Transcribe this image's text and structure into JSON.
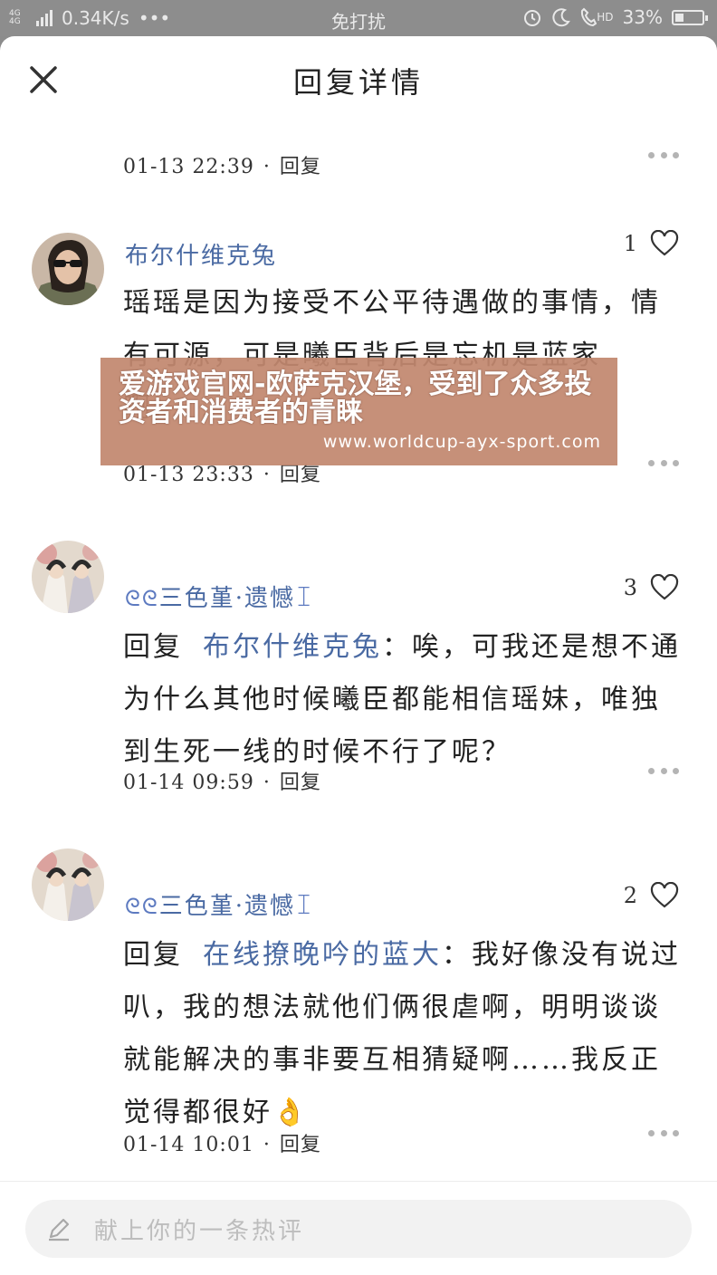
{
  "status_bar": {
    "network_tag": "4G 4G",
    "speed": "0.34K/s",
    "more_dots": "•••",
    "mode": "免打扰",
    "hd_label": "HD",
    "battery": "33%",
    "battery_level": 0.33
  },
  "header": {
    "title": "回复详情"
  },
  "top_meta": {
    "time": "01-13 22:39",
    "reply": "回复"
  },
  "comments": [
    {
      "user": "布尔什维克兔",
      "likes": "1",
      "text": "瑶瑶是因为接受不公平待遇做的事情，情有可源，可是曦臣背后是忘机是蓝家啊……",
      "time": "01-13 23:33",
      "reply": "回复"
    },
    {
      "user": "三色堇·遗憾",
      "deco_left": "ᘓᘓ",
      "deco_right": "ꀤ",
      "likes": "3",
      "reply_prefix": "回复",
      "mention": "布尔什维克兔",
      "colon": "：",
      "text": "唉，可我还是想不通为什么其他时候曦臣都能相信瑶妹，唯独到生死一线的时候不行了呢？",
      "time": "01-14 09:59",
      "reply": "回复"
    },
    {
      "user": "三色堇·遗憾",
      "deco_left": "ᘓᘓ",
      "deco_right": "ꀤ",
      "likes": "2",
      "reply_prefix": "回复",
      "mention": "在线撩晚吟的蓝大",
      "colon": "：",
      "text": "我好像没有说过叭，我的想法就他们俩很虐啊，明明谈谈就能解决的事非要互相猜疑啊……我反正觉得都很好👌",
      "time": "01-14 10:01",
      "reply": "回复"
    }
  ],
  "input": {
    "placeholder": "献上你的一条热评"
  },
  "ad": {
    "headline": "爱游戏官网-欧萨克汉堡，受到了众多投资者和消费者的青睐",
    "url": "www.worldcup-ayx-sport.com"
  },
  "colors": {
    "accent_link": "#4a6aa3",
    "ad_background": "#c2886f"
  }
}
